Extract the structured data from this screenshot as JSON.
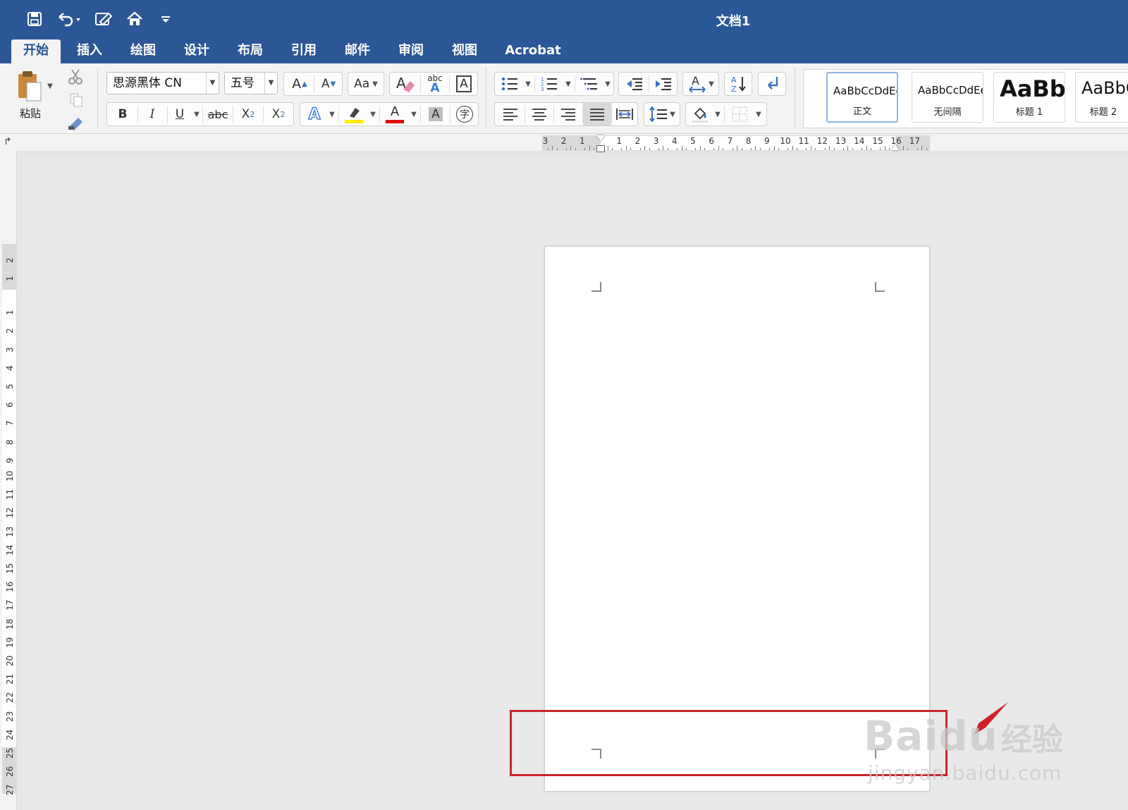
{
  "window": {
    "title": "文档1"
  },
  "qat": {
    "icons": [
      "save-icon",
      "undo-icon",
      "edit-document-icon",
      "home-icon",
      "customize-icon"
    ]
  },
  "tabs": [
    {
      "label": "开始",
      "active": true
    },
    {
      "label": "插入"
    },
    {
      "label": "绘图"
    },
    {
      "label": "设计"
    },
    {
      "label": "布局"
    },
    {
      "label": "引用"
    },
    {
      "label": "邮件"
    },
    {
      "label": "审阅"
    },
    {
      "label": "视图"
    },
    {
      "label": "Acrobat"
    }
  ],
  "clipboard": {
    "paste_label": "粘贴"
  },
  "font": {
    "family": "思源黑体 CN",
    "size": "五号",
    "bold": "B",
    "italic": "I",
    "underline": "U",
    "strike": "abc",
    "subscript_base": "X",
    "subscript_mark": "2",
    "superscript_base": "X",
    "superscript_mark": "2",
    "text_effect": "A",
    "font_color": "A",
    "char_shade": "A",
    "enclose_char": "字",
    "grow": "A",
    "shrink": "A",
    "change_case": "Aa",
    "phonetic_small": "abc",
    "phonetic_big": "A",
    "char_border": "A",
    "highlight_color": "#ffeb00",
    "font_color_value": "#e00000"
  },
  "styles": [
    {
      "sample": "AaBbCcDdEe",
      "name": "正文",
      "selected": true
    },
    {
      "sample": "AaBbCcDdEe",
      "name": "无间隔"
    },
    {
      "sample": "AaBbC",
      "name": "标题 1"
    },
    {
      "sample": "AaBbC",
      "name": "标题 2"
    }
  ],
  "hruler": {
    "left_numbers": [
      "3",
      "2",
      "1"
    ],
    "right_numbers": [
      "1",
      "2",
      "3",
      "4",
      "5",
      "6",
      "7",
      "8",
      "9",
      "10",
      "11",
      "12",
      "13",
      "14",
      "15",
      "16",
      "17"
    ]
  },
  "vruler": {
    "numbers": [
      "2",
      "1",
      "1",
      "2",
      "3",
      "4",
      "5",
      "6",
      "7",
      "8",
      "9",
      "10",
      "11",
      "12",
      "13",
      "14",
      "15",
      "16",
      "17",
      "18",
      "19",
      "20",
      "21",
      "22",
      "23",
      "24",
      "25",
      "26",
      "27"
    ]
  },
  "watermark": {
    "brand": "Bai",
    "brand2": "du",
    "cn": "经验",
    "url": "jingyan.baidu.com"
  },
  "colors": {
    "titlebar": "#2b5797",
    "highlight_box": "#c9262c"
  }
}
